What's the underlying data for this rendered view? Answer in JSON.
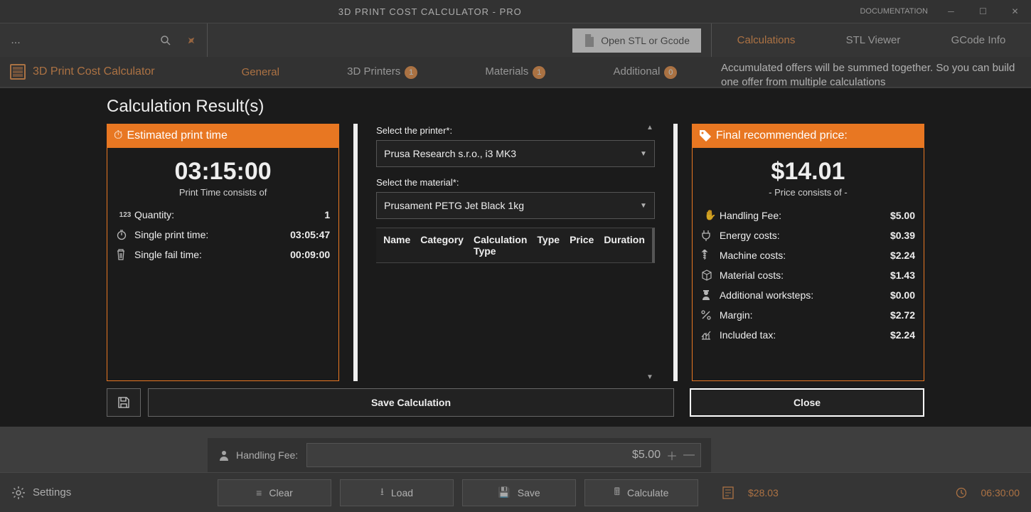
{
  "titlebar": {
    "title": "3D PRINT COST CALCULATOR - PRO",
    "documentation": "DOCUMENTATION"
  },
  "topbar": {
    "dots": "...",
    "open_button": "Open STL or Gcode",
    "right_tabs": {
      "calculations": "Calculations",
      "stl": "STL Viewer",
      "gcode": "GCode Info"
    }
  },
  "subbar": {
    "app_name": "3D Print Cost Calculator",
    "tabs": {
      "general": "General",
      "printers": "3D Printers",
      "printers_badge": "1",
      "materials": "Materials",
      "materials_badge": "1",
      "additional": "Additional",
      "additional_badge": "0"
    },
    "right_text": "Accumulated offers will be summed together. So you can build one offer from multiple calculations"
  },
  "handling": {
    "label": "Handling Fee:",
    "value": "$5.00"
  },
  "bottombar": {
    "settings": "Settings",
    "clear": "Clear",
    "load": "Load",
    "save": "Save",
    "calculate": "Calculate",
    "total_price": "$28.03",
    "total_time": "06:30:00"
  },
  "modal": {
    "title": "Calculation Result(s)",
    "left": {
      "head": "Estimated print time",
      "big": "03:15:00",
      "sub": "Print Time consists of",
      "rows": {
        "qty_label": "Quantity:",
        "qty_val": "1",
        "single_label": "Single print time:",
        "single_val": "03:05:47",
        "fail_label": "Single fail time:",
        "fail_val": "00:09:00"
      }
    },
    "mid": {
      "printer_label": "Select the printer*:",
      "printer_value": "Prusa Research s.r.o., i3 MK3",
      "material_label": "Select the material*:",
      "material_value": "Prusament PETG Jet Black 1kg",
      "cols": {
        "name": "Name",
        "category": "Category",
        "calc": "Calculation Type",
        "type": "Type",
        "price": "Price",
        "duration": "Duration"
      }
    },
    "right": {
      "head": "Final recommended price:",
      "big": "$14.01",
      "sub": "- Price consists of -",
      "rows": {
        "handling_l": "Handling Fee:",
        "handling_v": "$5.00",
        "energy_l": "Energy costs:",
        "energy_v": "$0.39",
        "machine_l": "Machine costs:",
        "machine_v": "$2.24",
        "material_l": "Material costs:",
        "material_v": "$1.43",
        "worksteps_l": "Additional worksteps:",
        "worksteps_v": "$0.00",
        "margin_l": "Margin:",
        "margin_v": "$2.72",
        "tax_l": "Included tax:",
        "tax_v": "$2.24"
      }
    },
    "save_btn": "Save Calculation",
    "close_btn": "Close"
  }
}
